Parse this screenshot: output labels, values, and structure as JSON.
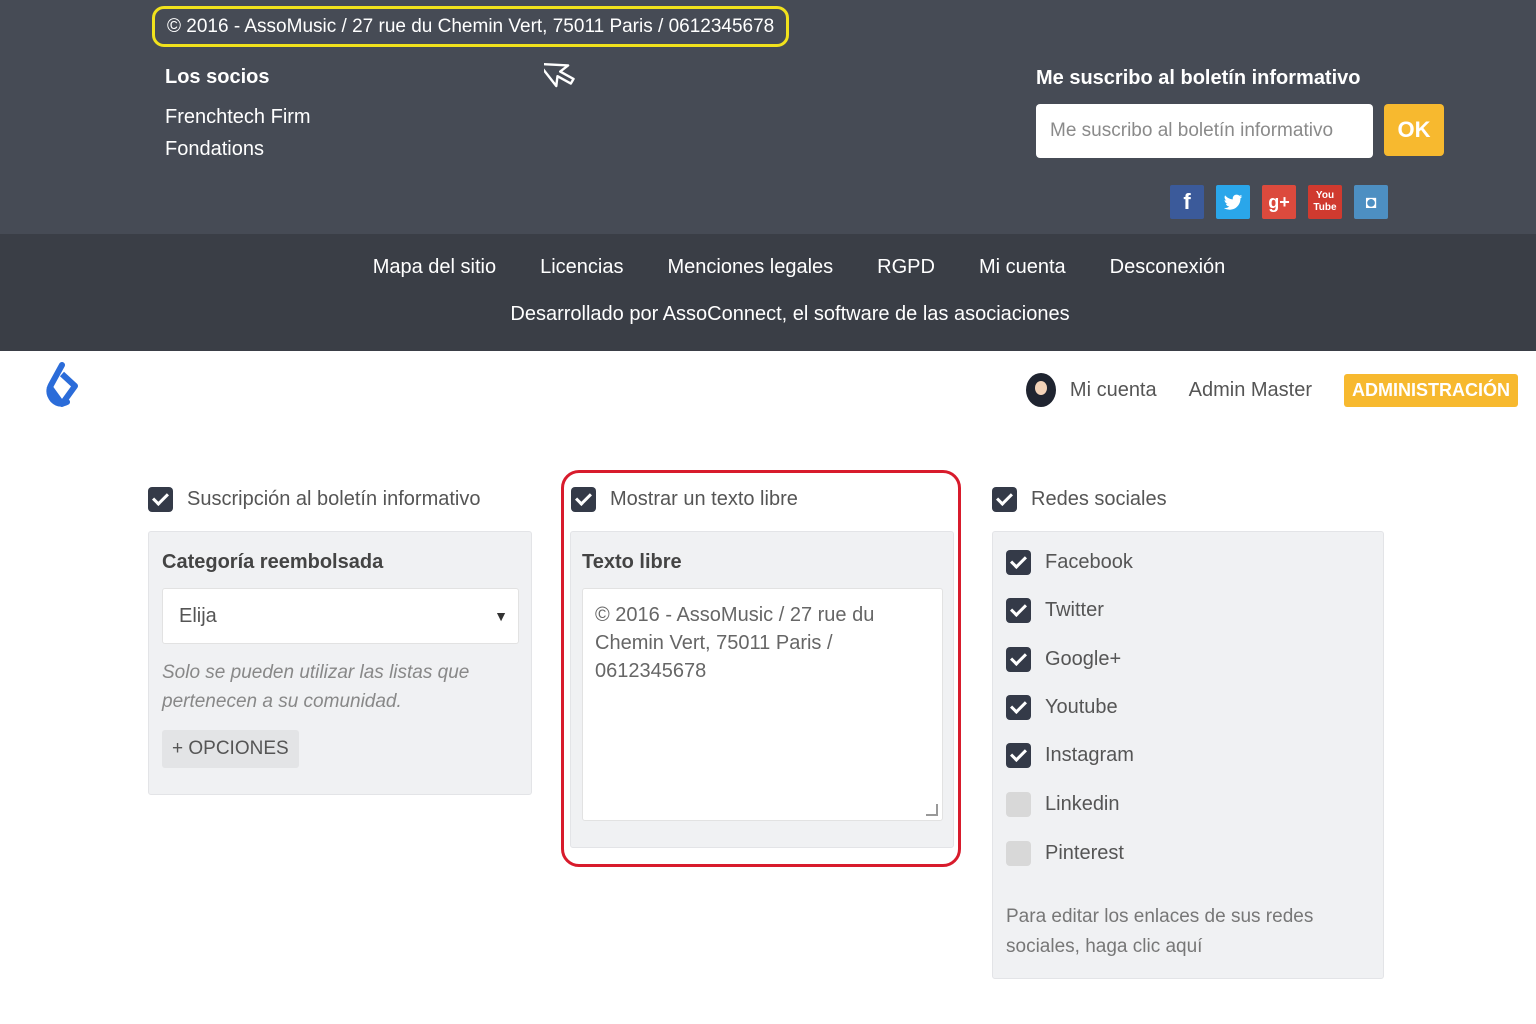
{
  "footer": {
    "copyright": "© 2016 - AssoMusic / 27 rue du Chemin Vert, 75011 Paris / 0612345678",
    "partners_title": "Los socios",
    "partners": [
      "Frenchtech Firm",
      "Fondations"
    ],
    "newsletter_title": "Me suscribo al boletín informativo",
    "newsletter_placeholder": "Me suscribo al boletín informativo",
    "ok_label": "OK",
    "social": {
      "facebook": "f",
      "twitter": "t",
      "googleplus": "g+",
      "youtube": "You\nTube",
      "instagram": "◘"
    },
    "links": [
      "Mapa del sitio",
      "Licencias",
      "Menciones legales",
      "RGPD",
      "Mi cuenta",
      "Desconexión"
    ],
    "powered_by": "Desarrollado por AssoConnect, el software de las asociaciones"
  },
  "header": {
    "my_account": "Mi cuenta",
    "user_name": "Admin Master",
    "admin_button": "ADMINISTRACIÓN"
  },
  "newsletter_block": {
    "toggle_label": "Suscripción al boletín informativo",
    "checked": true,
    "category_title": "Categoría reembolsada",
    "select_value": "Elija",
    "select_caret": "▼",
    "hint": "Solo se pueden utilizar las listas que pertenecen a su comunidad.",
    "options_button": "+ OPCIONES"
  },
  "free_text_block": {
    "toggle_label": "Mostrar un texto libre",
    "checked": true,
    "title": "Texto libre",
    "value": "© 2016 - AssoMusic / 27 rue du Chemin Vert, 75011 Paris / 0612345678"
  },
  "social_block": {
    "toggle_label": "Redes sociales",
    "checked": true,
    "networks": [
      {
        "label": "Facebook",
        "checked": true
      },
      {
        "label": "Twitter",
        "checked": true
      },
      {
        "label": "Google+",
        "checked": true
      },
      {
        "label": "Youtube",
        "checked": true
      },
      {
        "label": "Instagram",
        "checked": true
      },
      {
        "label": "Linkedin",
        "checked": false
      },
      {
        "label": "Pinterest",
        "checked": false
      }
    ],
    "hint": "Para editar los enlaces de sus redes sociales, haga clic aquí"
  },
  "colors": {
    "footer_bg": "#464b55",
    "footer_bottom_bg": "#3a3e46",
    "accent": "#f7b92f",
    "copyright_highlight": "#f1e21c",
    "free_text_highlight": "#d81b2c",
    "checkbox": "#343a48"
  }
}
